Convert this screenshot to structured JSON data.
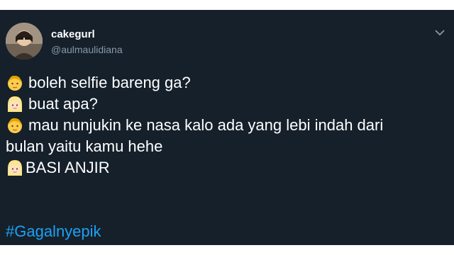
{
  "tweet": {
    "display_name": "cakegurl",
    "handle": "@aulmaulidiana",
    "lines": [
      {
        "emoji": "man-emoji",
        "text": "boleh selfie bareng ga?"
      },
      {
        "emoji": "woman-blond-emoji",
        "text": "buat apa?"
      },
      {
        "emoji": "man-emoji",
        "text": "mau nunjukin ke nasa kalo ada yang lebi indah dari"
      },
      {
        "emoji": "",
        "text": "bulan yaitu kamu hehe"
      },
      {
        "emoji": "woman-blond-emoji",
        "text": "BASI ANJIR"
      }
    ],
    "hashtag": "#Gagalnyepik"
  },
  "colors": {
    "background": "#15202b",
    "text": "#ffffff",
    "secondary": "#8899a6",
    "link": "#1da1f2"
  }
}
